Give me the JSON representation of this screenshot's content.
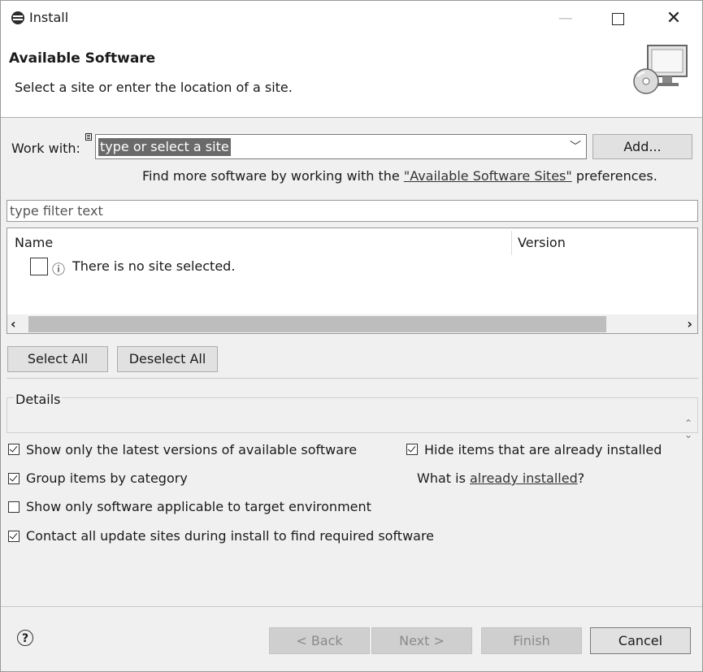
{
  "window": {
    "title": "Install",
    "minimize": "—",
    "maximize": "",
    "close": "✕"
  },
  "banner": {
    "heading": "Available Software",
    "subtitle": "Select a site or enter the location of a site."
  },
  "work_with": {
    "label": "Work with:",
    "value": "type or select a site",
    "add_label": "Add..."
  },
  "hint": {
    "prefix": "Find more software by working with the ",
    "link": "\"Available Software Sites\"",
    "suffix": " preferences."
  },
  "filter": {
    "placeholder": "type filter text"
  },
  "table": {
    "columns": [
      "Name",
      "Version"
    ],
    "rows": [
      {
        "text": "There is no site selected.",
        "icon": "info-icon",
        "checked": false
      }
    ]
  },
  "buttons": {
    "select_all": "Select All",
    "deselect_all": "Deselect All"
  },
  "details": {
    "label": "Details"
  },
  "options": [
    {
      "label": "Show only the latest versions of available software",
      "checked": true
    },
    {
      "label": "Hide items that are already installed",
      "checked": true
    },
    {
      "label": "Group items by category",
      "checked": true
    },
    {
      "label": "Show only software applicable to target environment",
      "checked": false
    },
    {
      "label": "Contact all update sites during install to find required software",
      "checked": true
    }
  ],
  "already_installed": {
    "prefix": "What is ",
    "link": "already installed",
    "suffix": "?"
  },
  "footer": {
    "help": "?",
    "back": "< Back",
    "next": "Next >",
    "finish": "Finish",
    "cancel": "Cancel"
  }
}
